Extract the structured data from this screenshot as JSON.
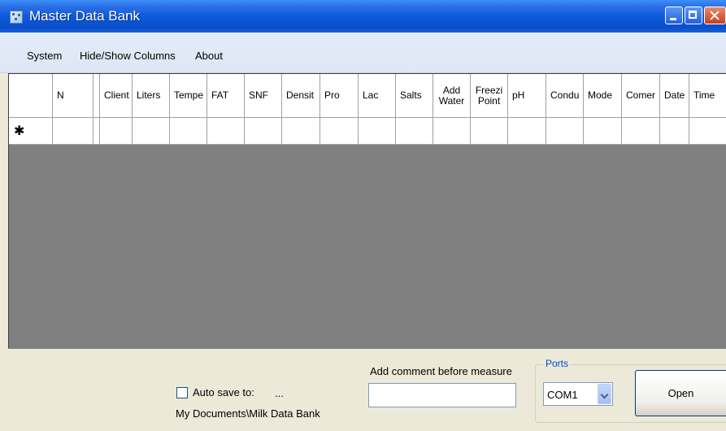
{
  "window": {
    "title": "Master Data Bank"
  },
  "menu": {
    "items": [
      "System",
      "Hide/Show Columns",
      "About"
    ]
  },
  "grid": {
    "columns": [
      {
        "label": "N"
      },
      {
        "label": ""
      },
      {
        "label": "Client"
      },
      {
        "label": "Liters"
      },
      {
        "label": "Tempe"
      },
      {
        "label": "FAT"
      },
      {
        "label": "SNF"
      },
      {
        "label": "Densit"
      },
      {
        "label": "Pro"
      },
      {
        "label": "Lac"
      },
      {
        "label": "Salts"
      },
      {
        "label": "Add",
        "label2": "Water"
      },
      {
        "label": "Freezi",
        "label2": "Point"
      },
      {
        "label": "pH"
      },
      {
        "label": "Condu"
      },
      {
        "label": "Mode"
      },
      {
        "label": "Comer"
      },
      {
        "label": "Date"
      },
      {
        "label": "Time"
      }
    ],
    "new_row_marker": "✱"
  },
  "bottom": {
    "autosave_label": "Auto save to:",
    "browse_label": "...",
    "autosave_path": "My Documents\\Milk Data Bank",
    "autosave_checked": false,
    "comment_label": "Add comment before measure",
    "comment_value": ""
  },
  "ports": {
    "legend": "Ports",
    "selected": "COM1",
    "open_label": "Open"
  },
  "colors": {
    "titlebar": "#0a57d9",
    "grid_background": "#808080",
    "ports_legend": "#0046d5"
  }
}
